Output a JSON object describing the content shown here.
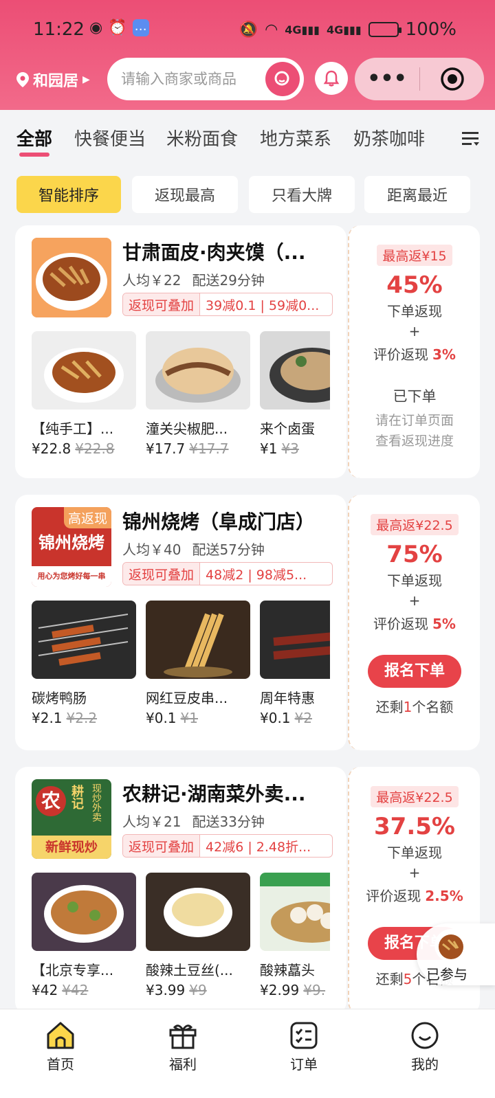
{
  "status": {
    "time": "11:22",
    "battery": "100%"
  },
  "header": {
    "location": "和园居",
    "search_placeholder": "请输入商家或商品"
  },
  "tabs": [
    "全部",
    "快餐便当",
    "米粉面食",
    "地方菜系",
    "奶茶咖啡"
  ],
  "filters": [
    "智能排序",
    "返现最高",
    "只看大牌",
    "距离最近"
  ],
  "shops": [
    {
      "name": "甘肃面皮·肉夹馍（...",
      "per_capita": "人均￥22",
      "delivery": "配送29分钟",
      "promo_label": "返现可叠加",
      "promo_text": "39减0.1 | 59减0...",
      "items": [
        {
          "name": "【纯手工】...",
          "price": "¥22.8",
          "orig": "¥22.8"
        },
        {
          "name": "潼关尖椒肥...",
          "price": "¥17.7",
          "orig": "¥17.7"
        },
        {
          "name": "来个卤蛋",
          "price": "¥1",
          "orig": "¥3"
        }
      ],
      "max_rebate": "最高返¥15",
      "percent": "45%",
      "order_rebate": "下单返现",
      "plus": "+",
      "review_label": "评价返现",
      "review_pct": "3%",
      "status": "已下单",
      "hint1": "请在订单页面",
      "hint2": "查看返现进度"
    },
    {
      "name": "锦州烧烤（阜成门店）",
      "logo_tag": "高返现",
      "logo_text": "锦州烧烤",
      "logo_slogan": "用心为您烤好每一串",
      "per_capita": "人均￥40",
      "delivery": "配送57分钟",
      "promo_label": "返现可叠加",
      "promo_text": "48减2 | 98减5...",
      "items": [
        {
          "name": "碳烤鸭肠",
          "price": "¥2.1",
          "orig": "¥2.2"
        },
        {
          "name": "网红豆皮串...",
          "price": "¥0.1",
          "orig": "¥1"
        },
        {
          "name": "周年特惠",
          "price": "¥0.1",
          "orig": "¥2"
        }
      ],
      "max_rebate": "最高返¥22.5",
      "percent": "75%",
      "order_rebate": "下单返现",
      "plus": "+",
      "review_label": "评价返现",
      "review_pct": "5%",
      "button": "报名下单",
      "quota_pre": "还剩",
      "quota_num": "1",
      "quota_post": "个名额"
    },
    {
      "name": "农耕记·湖南菜外卖...",
      "logo_text_1": "农",
      "logo_text_2": "耕记",
      "logo_text_3": "现炒外卖",
      "logo_slogan": "新鲜现炒",
      "per_capita": "人均￥21",
      "delivery": "配送33分钟",
      "promo_label": "返现可叠加",
      "promo_text": "42减6 | 2.48折...",
      "items": [
        {
          "name": "【北京专享...",
          "price": "¥42",
          "orig": "¥42"
        },
        {
          "name": "酸辣土豆丝(...",
          "price": "¥3.99",
          "orig": "¥9"
        },
        {
          "name": "酸辣藠头",
          "price": "¥2.99",
          "orig": "¥9."
        }
      ],
      "max_rebate": "最高返¥22.5",
      "percent": "37.5%",
      "order_rebate": "下单返现",
      "plus": "+",
      "review_label": "评价返现",
      "review_pct": "2.5%",
      "button": "报名下单",
      "quota_pre": "还剩",
      "quota_num": "5",
      "quota_post": "个名额"
    }
  ],
  "float_joined": "已参与",
  "nav": [
    "首页",
    "福利",
    "订单",
    "我的"
  ],
  "colors": {
    "brand": "#ec4e75",
    "accent_red": "#e34242",
    "filter_active": "#fbd64b"
  }
}
